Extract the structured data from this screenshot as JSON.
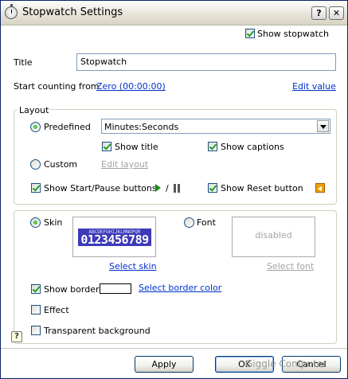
{
  "window": {
    "title": "Stopwatch Settings",
    "help_button": "?",
    "close_button": "✕"
  },
  "show_stopwatch": {
    "label": "Show stopwatch",
    "checked": true
  },
  "title_field": {
    "label": "Title",
    "value": "Stopwatch"
  },
  "start": {
    "label": "Start counting from",
    "value_link": "Zero (00:00:00)",
    "edit_link": "Edit value"
  },
  "layout": {
    "legend": "Layout",
    "predefined_label": "Predefined",
    "predefined_value": "Minutes:Seconds",
    "show_title": "Show title",
    "show_captions": "Show captions",
    "custom_label": "Custom",
    "edit_layout": "Edit layout",
    "show_start_pause": "Show Start/Pause buttons",
    "slash": "/",
    "show_reset": "Show Reset button"
  },
  "appearance": {
    "skin_label": "Skin",
    "skin_preview_small": "ABCDEFGHIJKLMNOPQR",
    "skin_preview_digits": "0123456789",
    "select_skin": "Select skin",
    "font_label": "Font",
    "font_preview": "disabled",
    "select_font": "Select font",
    "show_border": "Show border",
    "select_border_color": "Select border color",
    "effect": "Effect",
    "transparent_bg": "Transparent background"
  },
  "buttons": {
    "apply": "Apply",
    "ok": "OK",
    "cancel": "Cancel"
  },
  "watermark": "Giggle Computer",
  "colors": {
    "link": "#0033cc",
    "disabled": "#a3a3a3",
    "skin_bg": "#3d3ab8",
    "check_green": "#21a121"
  }
}
